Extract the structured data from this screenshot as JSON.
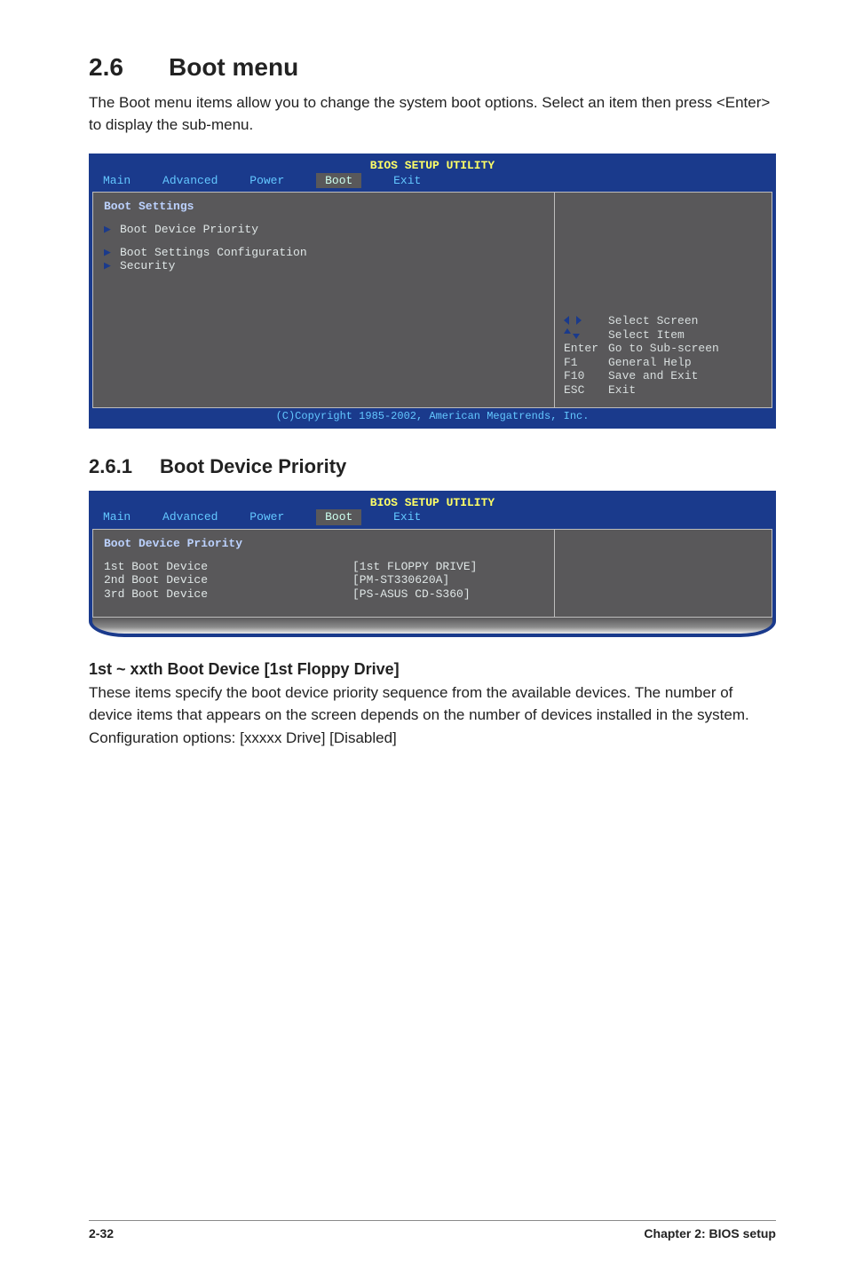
{
  "section": {
    "number": "2.6",
    "title": "Boot menu",
    "intro": "The Boot menu items allow you to change the system boot options. Select an item then press <Enter> to display the sub-menu."
  },
  "bios1": {
    "setup_title": "BIOS SETUP UTILITY",
    "tabs": [
      "Main",
      "Advanced",
      "Power",
      "Boot",
      "Exit"
    ],
    "heading": "Boot Settings",
    "items": [
      "Boot Device Priority",
      "Boot Settings Configuration",
      "Security"
    ],
    "help": {
      "select_screen": "Select Screen",
      "select_item": "Select Item",
      "enter_k": "Enter",
      "enter_v": "Go to Sub-screen",
      "f1_k": "F1",
      "f1_v": "General Help",
      "f10_k": "F10",
      "f10_v": "Save and Exit",
      "esc_k": "ESC",
      "esc_v": "Exit"
    },
    "copyright": "(C)Copyright 1985-2002, American Megatrends, Inc."
  },
  "subsection": {
    "number": "2.6.1",
    "title": "Boot Device Priority"
  },
  "bios2": {
    "setup_title": "BIOS SETUP UTILITY",
    "tabs": [
      "Main",
      "Advanced",
      "Power",
      "Boot",
      "Exit"
    ],
    "heading": "Boot Device Priority",
    "row1_k": "1st Boot Device",
    "row1_v": "[1st FLOPPY DRIVE]",
    "row2_k": "2nd Boot Device",
    "row2_v": "[PM-ST330620A]",
    "row3_k": "3rd Boot Device",
    "row3_v": "[PS-ASUS CD-S360]"
  },
  "subsub": {
    "title": "1st ~ xxth Boot Device [1st Floppy Drive]",
    "p1": "These items specify the boot device priority sequence from the available devices. The number of device items that appears on the screen depends on the number of devices installed in the system.",
    "p2": "Configuration options: [xxxxx Drive] [Disabled]"
  },
  "footer": {
    "page": "2-32",
    "chapter": "Chapter 2: BIOS setup"
  }
}
